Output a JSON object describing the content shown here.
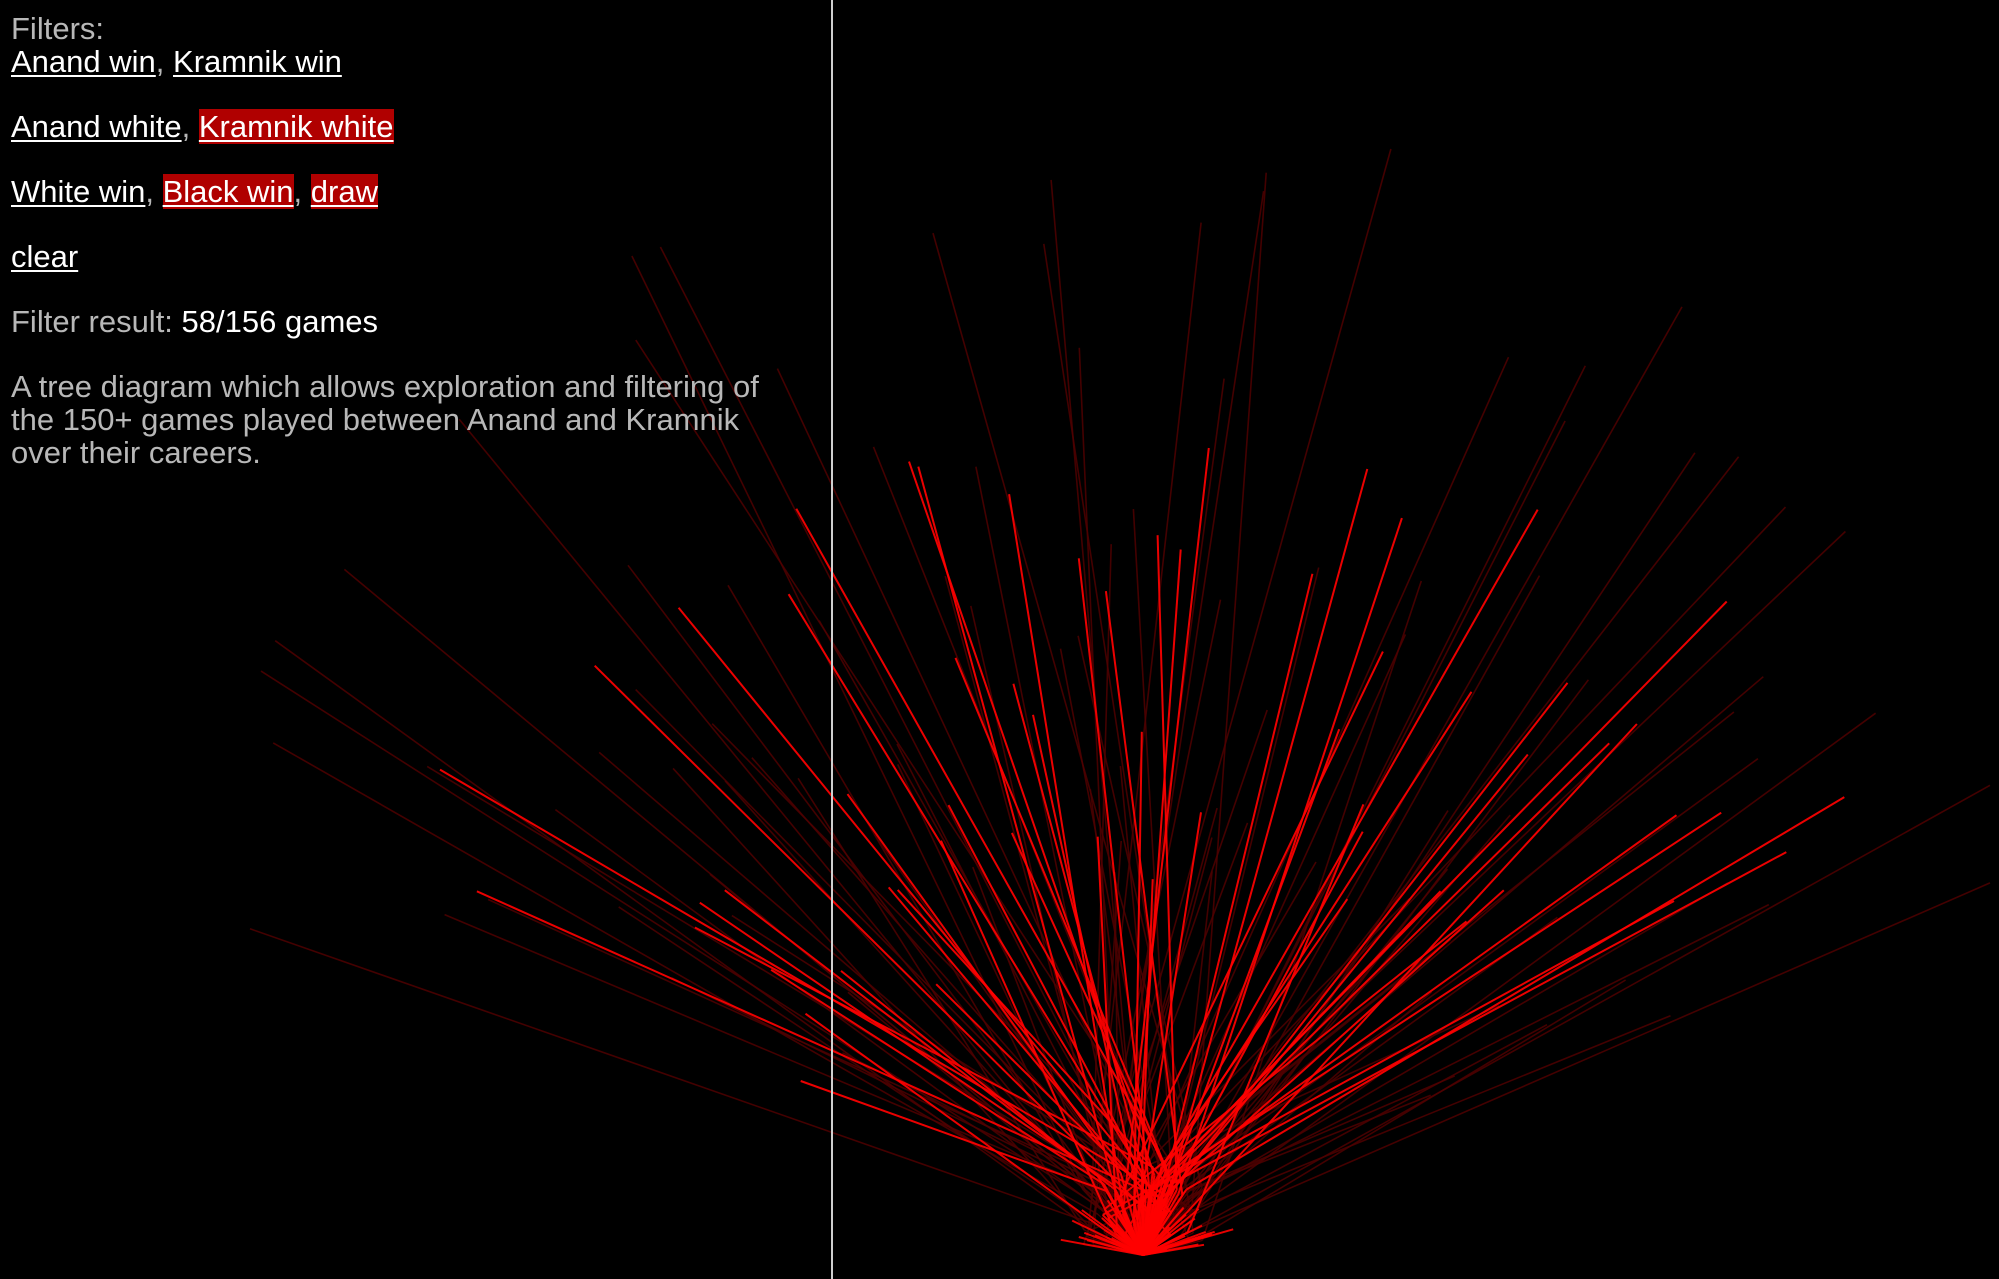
{
  "filters": {
    "label": "Filters:",
    "players": [
      {
        "label": "Anand win",
        "active": false
      },
      {
        "label": "Kramnik win",
        "active": false
      }
    ],
    "colors": [
      {
        "label": "Anand white",
        "active": false
      },
      {
        "label": "Kramnik white",
        "active": true
      }
    ],
    "results": [
      {
        "label": "White win",
        "active": false
      },
      {
        "label": "Black win",
        "active": true
      },
      {
        "label": "draw",
        "active": true
      }
    ],
    "clear_label": "clear"
  },
  "result": {
    "label": "Filter result:",
    "value": "58/156 games"
  },
  "description": "A tree diagram which allows exploration and filtering of the 150+ games played between Anand and Kramnik over their careers.",
  "colors": {
    "background": "#000000",
    "highlight": "#ff0000",
    "dim": "#500000",
    "active_filter": "#b00000",
    "link": "#ffffff",
    "label": "#b8b8b8"
  }
}
